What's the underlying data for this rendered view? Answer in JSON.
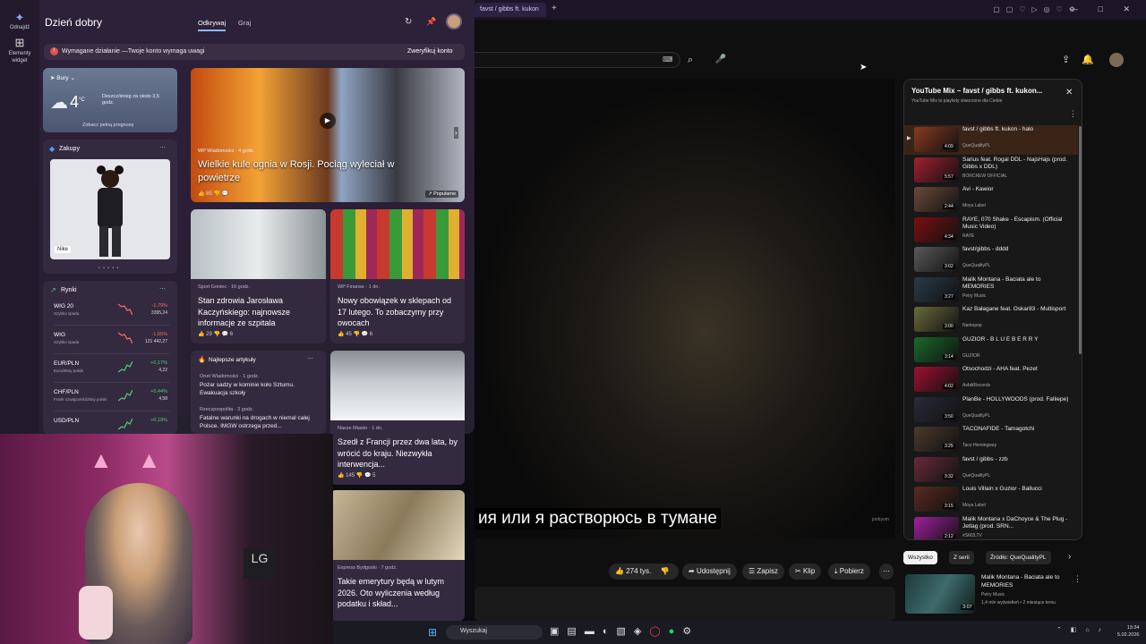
{
  "browser": {
    "tab_title": "favst / gibbs ft. kukon",
    "new_tab": "+",
    "window_controls": "— □ ✕"
  },
  "youtube": {
    "search_kbd": "⌨",
    "subtitle": "ия или я растворюсь в тумане",
    "watermark": "jonbyum",
    "actions": {
      "likes": "274 tys.",
      "share": "Udostępnij",
      "save": "Zapisz",
      "clip": "Klip",
      "download": "Pobierz",
      "more": "⋯"
    },
    "playlist": {
      "title": "YouTube Mix – favst / gibbs ft. kukon...",
      "subtitle": "YouTube Mix to playlisty stworzone dla Ciebie",
      "items": [
        {
          "title": "favst / gibbs ft. kukon - halo",
          "channel": "QueQualityPL",
          "duration": "4:09",
          "color": "#8a3a20",
          "active": true
        },
        {
          "title": "Sarius feat. Rogal DDL - NajsHajs (prod. Gibbs x DDL)",
          "channel": "BORCREW OFFICIAL",
          "duration": "5:57",
          "color": "#a12030"
        },
        {
          "title": "Avi - Kawior",
          "channel": "Moya Label",
          "duration": "2:44",
          "color": "#6a4a3a"
        },
        {
          "title": "RAYE, 070 Shake - Escapism. (Official Music Video)",
          "channel": "RAYE",
          "duration": "4:34",
          "color": "#7a1010"
        },
        {
          "title": "favst/gibbs - dddd",
          "channel": "QueQualityPL",
          "duration": "3:02",
          "color": "#5a5a5a"
        },
        {
          "title": "Malik Montana - Baciata ale to MEMORIES",
          "channel": "Petry Music",
          "duration": "3:27",
          "color": "#2a3a4a"
        },
        {
          "title": "Kaz Bałagane feat. Oskar83 - Multisport",
          "channel": "Narkopop",
          "duration": "3:00",
          "color": "#6a6a3a"
        },
        {
          "title": "GUZIOR - B L U E B E R R Y",
          "channel": "GUZIOR",
          "duration": "3:14",
          "color": "#1a6a2a"
        },
        {
          "title": "Otsochodzi - AHA feat. Pezet",
          "channel": "AsfaltRecords",
          "duration": "4:02",
          "color": "#a01030"
        },
        {
          "title": "PlanBe - HOLLYWOODS (prod. Falliepe)",
          "channel": "QueQualityPL",
          "duration": "3:50",
          "color": "#2a2a3a"
        },
        {
          "title": "TACONAFIDE - Tamagotchi",
          "channel": "Taco Hemingway",
          "duration": "3:25",
          "color": "#4a3a2a"
        },
        {
          "title": "favst / gibbs - zzb",
          "channel": "QueQualityPL",
          "duration": "3:32",
          "color": "#6a2a3a"
        },
        {
          "title": "Louis Villain x Guzior - Ballucci",
          "channel": "Moya Label",
          "duration": "3:15",
          "color": "#5a2a20"
        },
        {
          "title": "Malik Montana x DaChoyce & The Plug - Jetlag (prod. SRN...",
          "channel": "#SM2LTV",
          "duration": "2:12",
          "color": "#a020a0"
        }
      ]
    },
    "chips": [
      "Wszystko",
      "Z serii",
      "Źródło: QueQualityPL"
    ],
    "recommendation": {
      "title": "Malik Montana - Baciata ale to MEMORIES",
      "channel": "Petry Music",
      "meta": "1,4 mln wyświetleń • 2 miesiące temu",
      "duration": "3:07"
    }
  },
  "widgets": {
    "rail": {
      "discover": "Odnajdź",
      "add": "Elementy widget"
    },
    "greeting": "Dzień dobry",
    "tabs": [
      "Odkrywaj",
      "Graj"
    ],
    "alert": {
      "text": "Wymagane działanie —Twoje konto wymaga uwagi",
      "button": "Zweryfikuj konto"
    },
    "weather": {
      "location": "Bury",
      "temp": "4",
      "unit": "°C",
      "desc": "Deszcz/śnieg za około 3,5 godz.",
      "link": "Zobacz pełną prognozę"
    },
    "shopping": {
      "title": "Zakupy",
      "badge": "Nike",
      "dots": "• • • • •"
    },
    "markets": {
      "title": "Rynki",
      "rows": [
        {
          "name": "WIG 20",
          "sub": "Szybko spada",
          "change": "-1,79%",
          "value": "3395,24",
          "up": false
        },
        {
          "name": "WIG",
          "sub": "Szybko spada",
          "change": "-1,65%",
          "value": "121 442,27",
          "up": false
        },
        {
          "name": "EUR/PLN",
          "sub": "Euro/Złoty polski",
          "change": "+0,17%",
          "value": "4,22",
          "up": true
        },
        {
          "name": "CHF/PLN",
          "sub": "Frank szwajcarski/Złoty polski",
          "change": "+0,44%",
          "value": "4,58",
          "up": true
        },
        {
          "name": "USD/PLN",
          "sub": "",
          "change": "+0,19%",
          "value": "",
          "up": true
        }
      ]
    },
    "hero": {
      "source": "WP Wiadomości · 4 godz.",
      "title": "Wielkie kule ognia w Rosji. Pociąg wyleciał w powietrze",
      "reactions": "👍 85  👎  💬",
      "tag": "↗ Popularne"
    },
    "news": [
      {
        "source": "Sport Goniec · 16 godz.",
        "title": "Stan zdrowia Jarosława Kaczyńskiego: najnowsze informacje ze szpitala",
        "reactions": "👍 29   👎   💬 6"
      },
      {
        "source": "WP Finanse · 1 dn.",
        "title": "Nowy obowiązek w sklepach od 17 lutego. To zobaczymy przy owocach",
        "reactions": "👍 45   👎   💬 6"
      },
      {
        "source": "Nasze Miasto · 1 dn.",
        "title": "Szedł z Francji przez dwa lata, by wrócić do kraju. Niezwykła interwencja...",
        "reactions": "👍 145   👎   💬 5"
      },
      {
        "source": "Express Bydgoski · 7 godz.",
        "title": "Takie emerytury będą w lutym 2026. Oto wyliczenia według podatku i skład..."
      }
    ],
    "top_articles": {
      "title": "Najlepsze artykuły",
      "items": [
        {
          "source": "Onet Wiadomości · 1 godz.",
          "title": "Pożar sadzy w kominie koło Sztumu. Ewakuacja szkoły"
        },
        {
          "source": "Rzeczpospolita · 3 godz.",
          "title": "Fatalne warunki na drogach w niemal całej Polsce. IMGW ostrzega przed..."
        }
      ]
    }
  },
  "webcam": {
    "sign": "LG"
  },
  "taskbar": {
    "search": "Wyszukaj",
    "time": "13:34",
    "date": "5.02.2026"
  },
  "colors": {
    "yt_bg": "#0f0f0f",
    "widget_bg": "#2c2138",
    "accent": "#8fb8ff",
    "up": "#4ad07a",
    "down": "#ff6b6b"
  }
}
